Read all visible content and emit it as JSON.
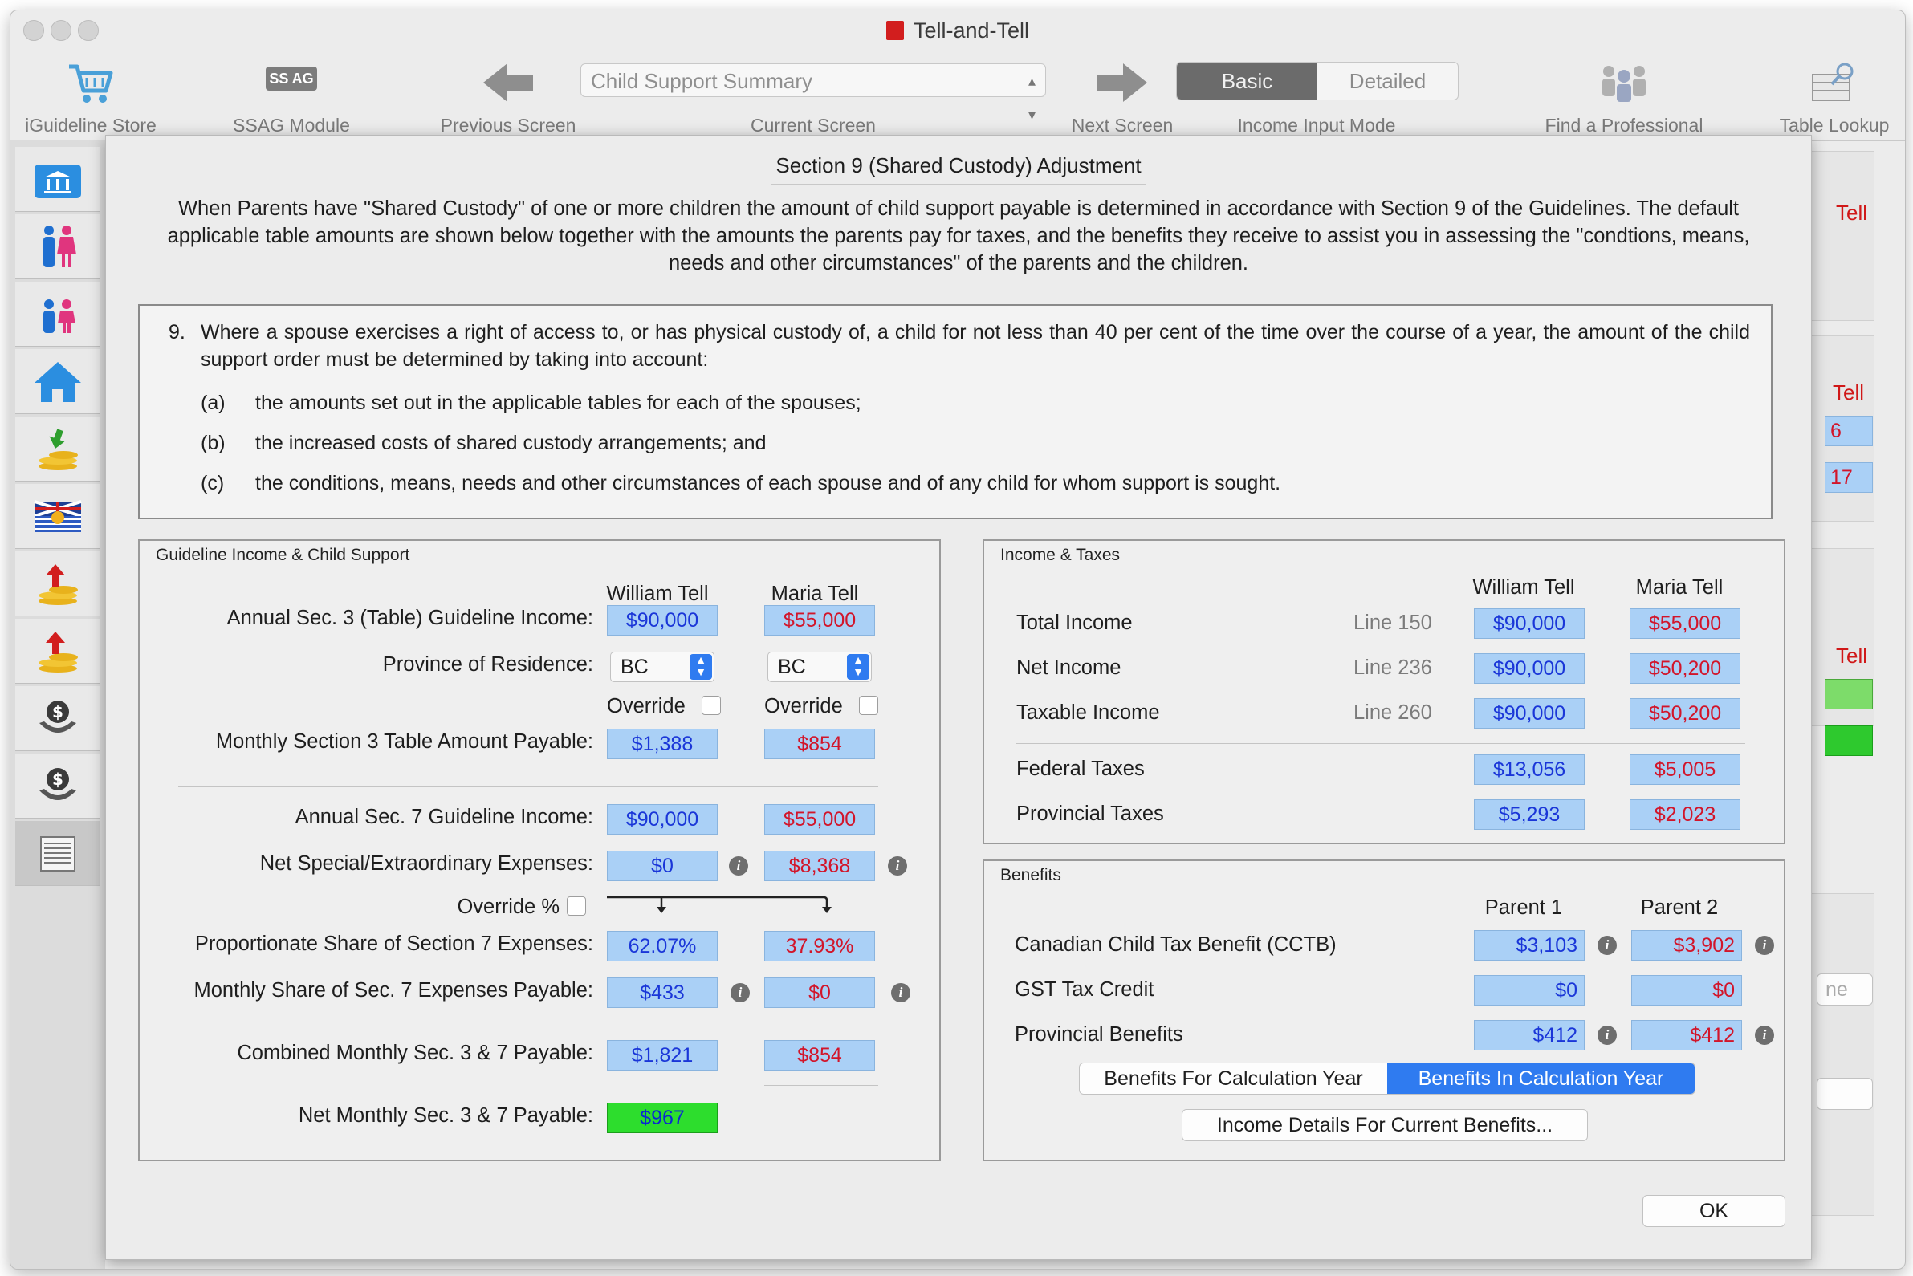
{
  "window": {
    "title": "Tell-and-Tell"
  },
  "toolbar": {
    "store": "iGuideline Store",
    "ssag_badge": "SS AG",
    "ssag": "SSAG Module",
    "previous": "Previous Screen",
    "current_select": "Child Support Summary",
    "current": "Current Screen",
    "next": "Next Screen",
    "mode_basic": "Basic",
    "mode_detailed": "Detailed",
    "mode_label": "Income Input Mode",
    "find_pro": "Find a Professional",
    "table_lookup": "Table Lookup"
  },
  "background": {
    "tell": "Tell",
    "v1": "6",
    "v2": "17",
    "placeholder": "ne"
  },
  "dialog": {
    "title": "Section 9 (Shared Custody) Adjustment",
    "intro": "When Parents have \"Shared Custody\" of one or more children the amount of child support payable is determined in accordance with Section 9 of the Guidelines. The default applicable table amounts are shown below together with the amounts the parents pay for taxes, and the benefits they receive to assist you in assessing the \"condtions, means, needs and other circumstances\" of the parents and the children.",
    "legal": {
      "num": "9.",
      "text": "Where a spouse exercises a right of access to, or has physical custody of, a child for not less than 40 per cent of the time over the course of a year, the amount of the child support order must be determined by taking into account:",
      "items": [
        {
          "k": "(a)",
          "t": "the amounts set out in the applicable tables for each of the spouses;"
        },
        {
          "k": "(b)",
          "t": "the increased costs of shared custody arrangements; and"
        },
        {
          "k": "(c)",
          "t": "the conditions, means, needs and other circumstances of each spouse and of any child for whom support is sought."
        }
      ]
    },
    "ok": "OK"
  },
  "guideline": {
    "title": "Guideline Income & Child Support",
    "p1": "William Tell",
    "p2": "Maria Tell",
    "annual_s3_label": "Annual Sec. 3 (Table) Guideline Income:",
    "annual_s3": [
      "$90,000",
      "$55,000"
    ],
    "province_label": "Province of Residence:",
    "province": [
      "BC",
      "BC"
    ],
    "override": "Override",
    "monthly_s3_label": "Monthly Section 3 Table Amount Payable:",
    "monthly_s3": [
      "$1,388",
      "$854"
    ],
    "annual_s7_label": "Annual Sec. 7 Guideline Income:",
    "annual_s7": [
      "$90,000",
      "$55,000"
    ],
    "net_special_label": "Net Special/Extraordinary Expenses:",
    "net_special": [
      "$0",
      "$8,368"
    ],
    "override_pct": "Override %",
    "prop_share_label": "Proportionate Share of Section 7 Expenses:",
    "prop_share": [
      "62.07%",
      "37.93%"
    ],
    "monthly_s7_label": "Monthly Share of Sec. 7 Expenses Payable:",
    "monthly_s7": [
      "$433",
      "$0"
    ],
    "combined_label": "Combined Monthly Sec. 3  & 7 Payable:",
    "combined": [
      "$1,821",
      "$854"
    ],
    "net_label": "Net Monthly Sec. 3  & 7 Payable:",
    "net": "$967"
  },
  "income": {
    "title": "Income & Taxes",
    "p1": "William Tell",
    "p2": "Maria Tell",
    "rows": [
      {
        "label": "Total Income",
        "line": "Line 150",
        "v1": "$90,000",
        "v2": "$55,000"
      },
      {
        "label": "Net Income",
        "line": "Line 236",
        "v1": "$90,000",
        "v2": "$50,200"
      },
      {
        "label": "Taxable Income",
        "line": "Line 260",
        "v1": "$90,000",
        "v2": "$50,200"
      }
    ],
    "federal_label": "Federal Taxes",
    "federal": [
      "$13,056",
      "$5,005"
    ],
    "provincial_label": "Provincial Taxes",
    "provincial": [
      "$5,293",
      "$2,023"
    ]
  },
  "benefits": {
    "title": "Benefits",
    "p1": "Parent 1",
    "p2": "Parent 2",
    "cctb_label": "Canadian Child Tax Benefit (CCTB)",
    "cctb": [
      "$3,103",
      "$3,902"
    ],
    "gst_label": "GST Tax Credit",
    "gst": [
      "$0",
      "$0"
    ],
    "prov_label": "Provincial Benefits",
    "prov": [
      "$412",
      "$412"
    ],
    "seg_for": "Benefits For Calculation Year",
    "seg_in": "Benefits In Calculation Year",
    "details_btn": "Income Details For Current Benefits..."
  }
}
